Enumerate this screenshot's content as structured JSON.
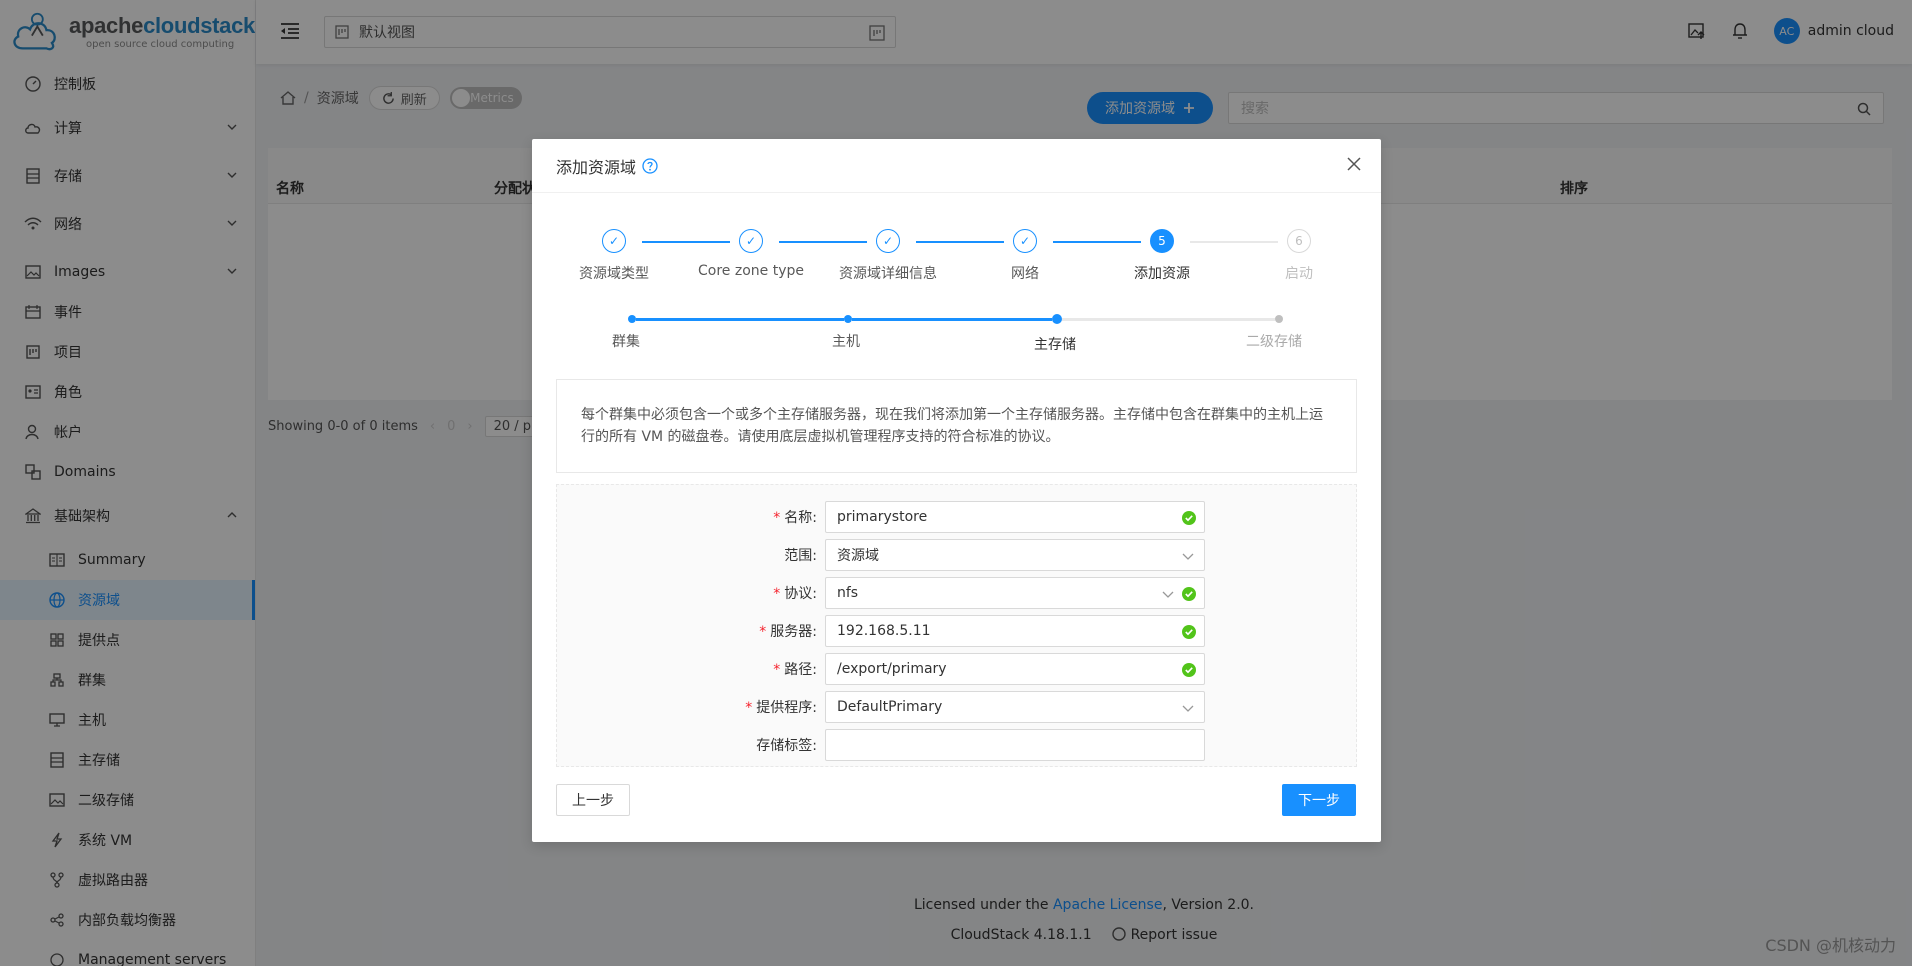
{
  "logo": {
    "brand_a": "apache",
    "brand_b": "cloudstack",
    "tagline": "open source cloud computing"
  },
  "sidebar": {
    "items": [
      {
        "label": "控制板"
      },
      {
        "label": "计算"
      },
      {
        "label": "存储"
      },
      {
        "label": "网络"
      },
      {
        "label": "Images"
      },
      {
        "label": "事件"
      },
      {
        "label": "项目"
      },
      {
        "label": "角色"
      },
      {
        "label": "帐户"
      },
      {
        "label": "Domains"
      },
      {
        "label": "基础架构"
      }
    ],
    "subitems": [
      {
        "label": "Summary"
      },
      {
        "label": "资源域"
      },
      {
        "label": "提供点"
      },
      {
        "label": "群集"
      },
      {
        "label": "主机"
      },
      {
        "label": "主存储"
      },
      {
        "label": "二级存储"
      },
      {
        "label": "系统 VM"
      },
      {
        "label": "虚拟路由器"
      },
      {
        "label": "内部负载均衡器"
      },
      {
        "label": "Management servers"
      }
    ]
  },
  "header": {
    "view_selector": "默认视图",
    "user_initials": "AC",
    "user_name": "admin cloud"
  },
  "page": {
    "breadcrumb": "资源域",
    "refresh_label": "刷新",
    "metrics_label": "Metrics",
    "add_button": "添加资源域",
    "search_placeholder": "搜索",
    "columns": [
      "名称",
      "分配状",
      "排序"
    ],
    "pager_text": "Showing 0-0 of 0 items",
    "pager_page": "0",
    "pager_size": "20 / p"
  },
  "footer": {
    "license_pre": "Licensed under the",
    "license_link": "Apache License",
    "license_post": ", Version 2.0.",
    "version": "CloudStack 4.18.1.1",
    "report": "Report issue"
  },
  "watermark": "CSDN @机核动力",
  "modal": {
    "title": "添加资源域",
    "steps": [
      {
        "label": "资源域类型",
        "state": "done"
      },
      {
        "label": "Core zone type",
        "state": "done"
      },
      {
        "label": "资源域详细信息",
        "state": "done"
      },
      {
        "label": "网络",
        "state": "done"
      },
      {
        "label": "添加资源",
        "state": "current",
        "num": "5"
      },
      {
        "label": "启动",
        "state": "wait",
        "num": "6"
      }
    ],
    "substeps": [
      "群集",
      "主机",
      "主存储",
      "二级存储"
    ],
    "info": "每个群集中必须包含一个或多个主存储服务器，现在我们将添加第一个主存储服务器。主存储中包含在群集中的主机上运行的所有 VM 的磁盘卷。请使用底层虚拟机管理程序支持的符合标准的协议。",
    "form": {
      "name": {
        "label": "名称",
        "value": "primarystore"
      },
      "scope": {
        "label": "范围",
        "value": "资源域"
      },
      "protocol": {
        "label": "协议",
        "value": "nfs"
      },
      "server": {
        "label": "服务器",
        "value": "192.168.5.11"
      },
      "path": {
        "label": "路径",
        "value": "/export/primary"
      },
      "provider": {
        "label": "提供程序",
        "value": "DefaultPrimary"
      },
      "tags": {
        "label": "存储标签",
        "value": ""
      }
    },
    "prev_label": "上一步",
    "next_label": "下一步"
  },
  "colors": {
    "primary": "#1890ff",
    "success": "#52c41a",
    "required": "#f5222d"
  }
}
